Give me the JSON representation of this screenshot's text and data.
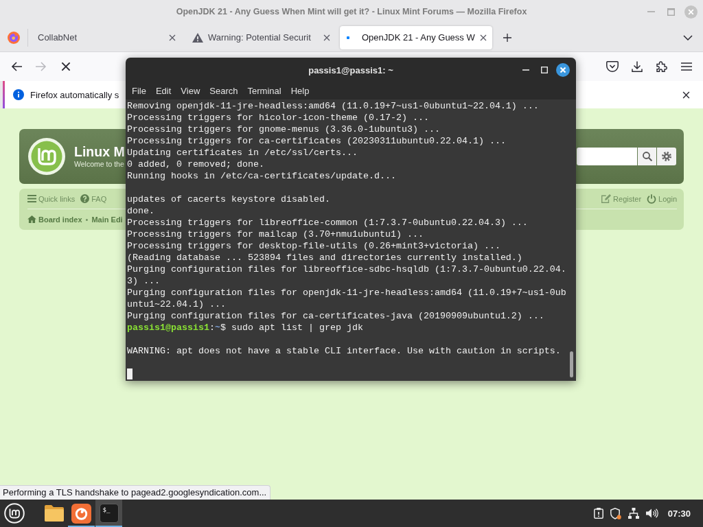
{
  "browser": {
    "title": "OpenJDK 21 - Any Guess When Mint will get it? - Linux Mint Forums — Mozilla Firefox",
    "tabs": [
      {
        "title": "CollabNet",
        "kind": "plain",
        "selected": false
      },
      {
        "title": "Warning: Potential Securit",
        "kind": "warning",
        "selected": false
      },
      {
        "title": "OpenJDK 21 - Any Guess W",
        "kind": "loading",
        "selected": true
      }
    ],
    "navigation": {
      "forward_disabled": true,
      "loading": true
    },
    "notification": {
      "text": "Firefox automatically s"
    },
    "status_text": "Performing a TLS handshake to pagead2.googlesyndication.com..."
  },
  "forum": {
    "site_title": "Linux M",
    "tagline": "Welcome to the",
    "links_left": [
      {
        "label": "Quick links",
        "kind": "menu"
      },
      {
        "label": "FAQ",
        "kind": "help"
      }
    ],
    "links_right": [
      {
        "label": "Register",
        "kind": "register"
      },
      {
        "label": "Login",
        "kind": "login"
      }
    ],
    "breadcrumbs": [
      {
        "label": "Board index",
        "kind": "home"
      },
      {
        "label": "Main Edi",
        "kind": "plain"
      }
    ],
    "breadcrumb_separator": "•"
  },
  "terminal": {
    "title": "passis1@passis1: ~",
    "menu": [
      "File",
      "Edit",
      "View",
      "Search",
      "Terminal",
      "Help"
    ],
    "blocks": [
      [
        {
          "text": "Removing openjdk-11-jre-headless:amd64 (11.0.19+7~us1-0ubuntu1~22.04.1) ..."
        },
        {
          "text": "Processing triggers for hicolor-icon-theme (0.17-2) ..."
        },
        {
          "text": "Processing triggers for gnome-menus (3.36.0-1ubuntu3) ..."
        },
        {
          "text": "Processing triggers for ca-certificates (20230311ubuntu0.22.04.1) ..."
        },
        {
          "text": "Updating certificates in /etc/ssl/certs..."
        },
        {
          "text": "0 added, 0 removed; done."
        },
        {
          "text": "Running hooks in /etc/ca-certificates/update.d..."
        }
      ],
      [
        {
          "text": "updates of cacerts keystore disabled."
        },
        {
          "text": "done."
        },
        {
          "text": "Processing triggers for libreoffice-common (1:7.3.7-0ubuntu0.22.04.3) ..."
        },
        {
          "text": "Processing triggers for mailcap (3.70+nmu1ubuntu1) ..."
        },
        {
          "text": "Processing triggers for desktop-file-utils (0.26+mint3+victoria) ..."
        },
        {
          "text": "(Reading database ... 523894 files and directories currently installed.)"
        },
        {
          "text": "Purging configuration files for libreoffice-sdbc-hsqldb (1:7.3.7-0ubuntu0.22.04."
        },
        {
          "text": "3) ..."
        },
        {
          "text": "Purging configuration files for openjdk-11-jre-headless:amd64 (11.0.19+7~us1-0ub"
        },
        {
          "text": "untu1~22.04.1) ..."
        },
        {
          "text": "Purging configuration files for ca-certificates-java (20190909ubuntu1.2) ..."
        },
        {
          "user": "passis1@passis1",
          "separator": ":",
          "path": "~",
          "text": "$ sudo apt list | grep jdk"
        }
      ],
      [
        {
          "text": "WARNING: apt does not have a stable CLI interface. Use with caution in scripts."
        }
      ]
    ],
    "cursor": true
  },
  "taskbar": {
    "apps": [
      {
        "kind": "files",
        "running": false,
        "selected": false
      },
      {
        "kind": "browser",
        "running": true,
        "selected": false
      },
      {
        "kind": "terminal",
        "running": true,
        "selected": true,
        "glyph": "$_"
      }
    ],
    "clock": "07:30"
  }
}
